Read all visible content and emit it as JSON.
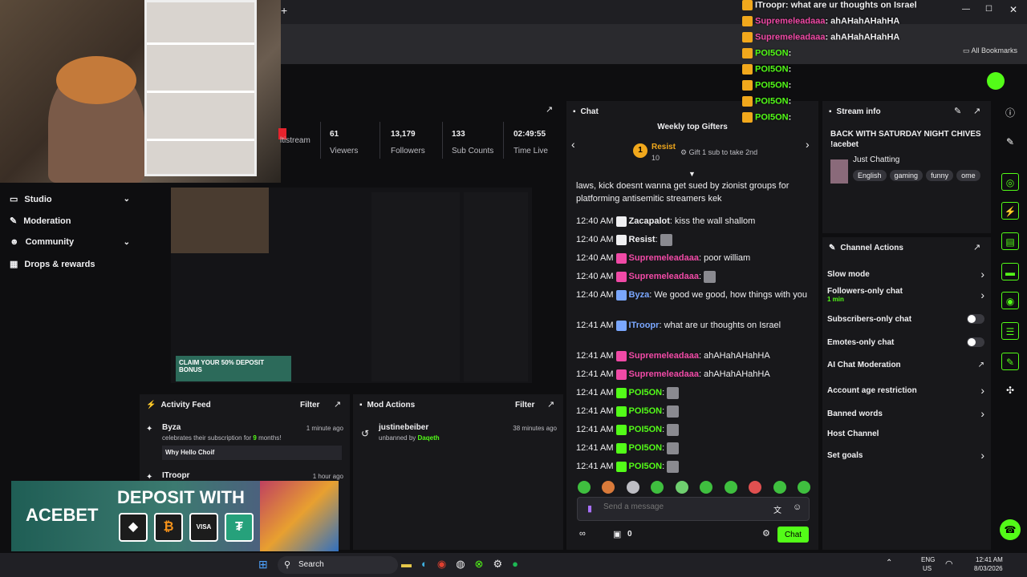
{
  "browser": {
    "new_tab": "+",
    "bookmarks": "All Bookmarks"
  },
  "nav": {
    "items": [
      {
        "label": "Studio",
        "chevron": "⌄"
      },
      {
        "label": "Moderation"
      },
      {
        "label": "Community",
        "chevron": "⌄"
      },
      {
        "label": "Drops & rewards"
      }
    ]
  },
  "stats": [
    {
      "value": "",
      "label": "ltistream"
    },
    {
      "value": "61",
      "label": "Viewers"
    },
    {
      "value": "13,179",
      "label": "Followers"
    },
    {
      "value": "133",
      "label": "Sub Counts"
    },
    {
      "value": "02:49:55",
      "label": "Time Live"
    }
  ],
  "chat": {
    "title": "Chat",
    "gifters_title": "Weekly top Gifters",
    "top_gifter": {
      "rank": "1",
      "name": "Resist",
      "count": "10"
    },
    "gift_hint": "Gift 1 sub to take 2nd",
    "messages": [
      {
        "ts": "",
        "user": "",
        "text": "laws, kick doesnt wanna get sued by zionist groups for platforming antisemitic streamers kek",
        "color": "#efeff1"
      },
      {
        "ts": "12:40 AM",
        "user": "Zacapalot",
        "text": "kiss the wall shallom",
        "color": "#efeff1"
      },
      {
        "ts": "12:40 AM",
        "user": "Resist",
        "text": "",
        "color": "#efeff1"
      },
      {
        "ts": "12:40 AM",
        "user": "Supremeleadaaa",
        "text": "poor william",
        "color": "#f04aa6"
      },
      {
        "ts": "12:40 AM",
        "user": "Supremeleadaaa",
        "text": "",
        "color": "#f04aa6"
      },
      {
        "ts": "12:40 AM",
        "user": "Byza",
        "text": "We good we good, how things with you",
        "color": "#7aa7ff"
      },
      {
        "ts": "12:41 AM",
        "user": "ITroopr",
        "text": "what are ur thoughts on Israel",
        "color": "#7aa7ff"
      },
      {
        "ts": "12:41 AM",
        "user": "Supremeleadaaa",
        "text": "ahAHahAHahHA",
        "color": "#f04aa6"
      },
      {
        "ts": "12:41 AM",
        "user": "Supremeleadaaa",
        "text": "ahAHahAHahHA",
        "color": "#f04aa6"
      },
      {
        "ts": "12:41 AM",
        "user": "POI5ON",
        "text": "",
        "color": "#53fc18"
      },
      {
        "ts": "12:41 AM",
        "user": "POI5ON",
        "text": "",
        "color": "#53fc18"
      },
      {
        "ts": "12:41 AM",
        "user": "POI5ON",
        "text": "",
        "color": "#53fc18"
      },
      {
        "ts": "12:41 AM",
        "user": "POI5ON",
        "text": "",
        "color": "#53fc18"
      },
      {
        "ts": "12:41 AM",
        "user": "POI5ON",
        "text": "",
        "color": "#53fc18"
      }
    ],
    "placeholder": "Send a message",
    "points": "0",
    "send_label": "Chat"
  },
  "overlay": [
    {
      "user": "ITroopr",
      "text": "what are ur thoughts on Israel",
      "color": "#efeff1"
    },
    {
      "user": "Supremeleadaaa",
      "text": "ahAHahAHahHA",
      "color": "#f04aa6"
    },
    {
      "user": "Supremeleadaaa",
      "text": "ahAHahAHahHA",
      "color": "#f04aa6"
    },
    {
      "user": "POI5ON",
      "text": "",
      "color": "#53fc18"
    },
    {
      "user": "POI5ON",
      "text": "",
      "color": "#53fc18"
    },
    {
      "user": "POI5ON",
      "text": "",
      "color": "#53fc18"
    },
    {
      "user": "POI5ON",
      "text": "",
      "color": "#53fc18"
    },
    {
      "user": "POI5ON",
      "text": "",
      "color": "#53fc18"
    }
  ],
  "stream_info": {
    "title": "Stream info",
    "stream_title": "BACK WITH SATURDAY NIGHT CHIVES !acebet",
    "category": "Just Chatting",
    "tags": [
      "English",
      "gaming",
      "funny",
      "ome"
    ]
  },
  "channel_actions": {
    "title": "Channel Actions",
    "items": [
      {
        "label": "Slow mode",
        "kind": "arrow"
      },
      {
        "label": "Followers-only chat",
        "sub": "1 min",
        "kind": "arrow"
      },
      {
        "label": "Subscribers-only chat",
        "kind": "toggle"
      },
      {
        "label": "Emotes-only chat",
        "kind": "toggle"
      },
      {
        "label": "AI Chat Moderation",
        "kind": "ext"
      },
      {
        "label": "Account age restriction",
        "kind": "arrow"
      },
      {
        "label": "Banned words",
        "kind": "arrow"
      },
      {
        "label": "Host Channel",
        "kind": "none"
      },
      {
        "label": "Set goals",
        "kind": "arrow"
      }
    ]
  },
  "activity": {
    "title": "Activity Feed",
    "filter": "Filter",
    "items": [
      {
        "user": "Byza",
        "time": "1 minute ago",
        "desc_pre": "celebrates their subscription for ",
        "months": "9",
        "desc_post": " months!",
        "message": "Why Hello Choif"
      },
      {
        "user": "ITroopr",
        "time": "1 hour ago"
      }
    ]
  },
  "mod_actions": {
    "title": "Mod Actions",
    "filter": "Filter",
    "items": [
      {
        "user": "justinebeiber",
        "time": "38 minutes ago",
        "desc": "unbanned by ",
        "mod": "Daqeth"
      }
    ]
  },
  "ad": {
    "brand": "ACEBET",
    "headline": "DEPOSIT WITH",
    "preview_text": "CLAIM YOUR 50% DEPOSIT BONUS"
  },
  "taskbar": {
    "search": "Search",
    "lang": "ENG",
    "region": "US",
    "time": "12:41 AM",
    "date": "8/03/2026"
  }
}
